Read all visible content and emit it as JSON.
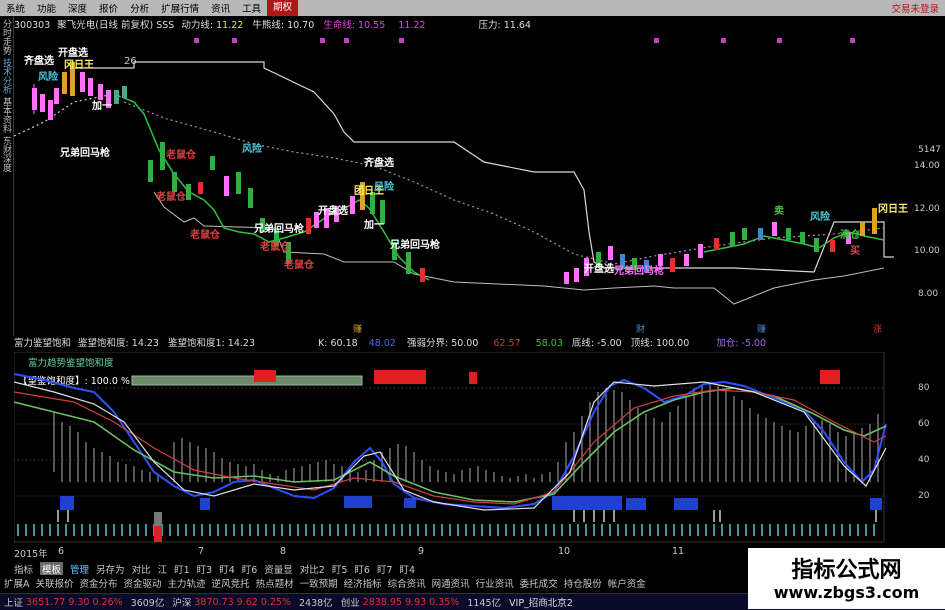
{
  "menu": {
    "items": [
      "系统",
      "功能",
      "深度",
      "报价",
      "分析",
      "扩展行情",
      "资讯",
      "工具",
      "期权"
    ],
    "active": "期权",
    "right_text": "交易未登录"
  },
  "sidebar": {
    "tabs": [
      "分时走势",
      "技术分析",
      "基本资料",
      "东财深度"
    ]
  },
  "header": {
    "code": "300303",
    "name": "聚飞光电(日线 前复权) SSS",
    "dongli_label": "动力线:",
    "dongli_value": "11.22",
    "niuli_label": "牛熊线:",
    "niuli_value": "10.70",
    "shengming_label": "生命线:",
    "shengming_value": "10.55",
    "v4": "11.22",
    "yali_label": "压力:",
    "yali_value": "11.64"
  },
  "price_axis": {
    "labels": [
      "5147",
      "14.00",
      "12.00",
      "10.00",
      "8.00"
    ]
  },
  "main_labels": {
    "top_left": "开盘选",
    "k1": "齐盘选",
    "k2": "冈日王",
    "k3": "加一",
    "k4": "风险",
    "k5": "兄弟回马枪",
    "k6": "老鼠仓",
    "k7": "老鼠仓",
    "k8": "老鼠仓",
    "k9": "兄弟回马枪",
    "k10": "风险",
    "k11": "齐盘选",
    "k12": "团日王",
    "k13": "开盘选",
    "k14": "加一",
    "k15": "兄弟回马枪",
    "k16": "老鼠仓",
    "k17": "老鼠仓",
    "k18": "风险",
    "k19": "开盘选",
    "k20": "兄弟回马枪",
    "k21": "卖",
    "k22": "风险",
    "k23": "清仓",
    "k24": "冈日王",
    "k25": "买",
    "tick": "26"
  },
  "indicator_header": {
    "t1": "富力鉴望饱和",
    "t2": "鉴望饱和度:",
    "v2": "14.23",
    "t3": "鉴望饱和度1:",
    "v3": "14.23",
    "k_label": "K:",
    "k_value": "60.18",
    "d_value": "48.02",
    "strong_label": "强弱分界:",
    "strong_value": "50.00",
    "mm_value": "62.57",
    "mm2_value": "58.03",
    "di_label": "底线:",
    "di_value": "-5.00",
    "ding_label": "顶线:",
    "ding_value": "100.00",
    "jia_label": "加仓:",
    "jia_value": "-5.00",
    "mk1": "赚",
    "mk2": "财",
    "mk3": "赚",
    "mk4": "涨"
  },
  "indicator_labels": {
    "l1": "富力趋势鉴望饱和度",
    "l2": "【望鉴饱和度】: 100.0 %"
  },
  "ind_axis": {
    "labels": [
      "80",
      "60",
      "40",
      "20"
    ]
  },
  "dates": [
    "2015年",
    "6",
    "7",
    "8",
    "9",
    "10",
    "11"
  ],
  "tabs": [
    "指标",
    "模板",
    "管理",
    "另存为",
    "对比",
    "江",
    "盯1",
    "盯3",
    "盯4",
    "盯6",
    "资量显",
    "对比2",
    "盯5",
    "盯6",
    "盯7",
    "盯4"
  ],
  "tabs_selected": "模板",
  "tabs2": [
    "扩展A",
    "关联报价",
    "资金分布",
    "资金驱动",
    "主力轨迹",
    "逆风竞托",
    "热点题材",
    "一致预期",
    "经济指标",
    "综合资讯",
    "网通资讯",
    "行业资讯",
    "委托成交",
    "持仓股份",
    "帐户资金"
  ],
  "status": {
    "shz_label": "上证",
    "shz_value": "3651.77",
    "shz_chg": "9.30",
    "shz_pct": "0.26%",
    "shz_vol": "3609亿",
    "hs_label": "沪深",
    "hs_value": "3870.73",
    "hs_chg": "9.62",
    "hs_pct": "0.25%",
    "hs_vol": "2438亿",
    "cy_label": "创业",
    "cy_value": "2838.95",
    "cy_chg": "9.93",
    "cy_pct": "0.35%",
    "cy_vol": "1145亿",
    "vip": "VIP_招商北京2"
  },
  "watermark": {
    "title": "指标公式网",
    "url": "www.zbgs3.com"
  },
  "colors": {
    "up": "#e03030",
    "down": "#30b040",
    "accent": "#d040d0",
    "gold": "#e0a030"
  }
}
